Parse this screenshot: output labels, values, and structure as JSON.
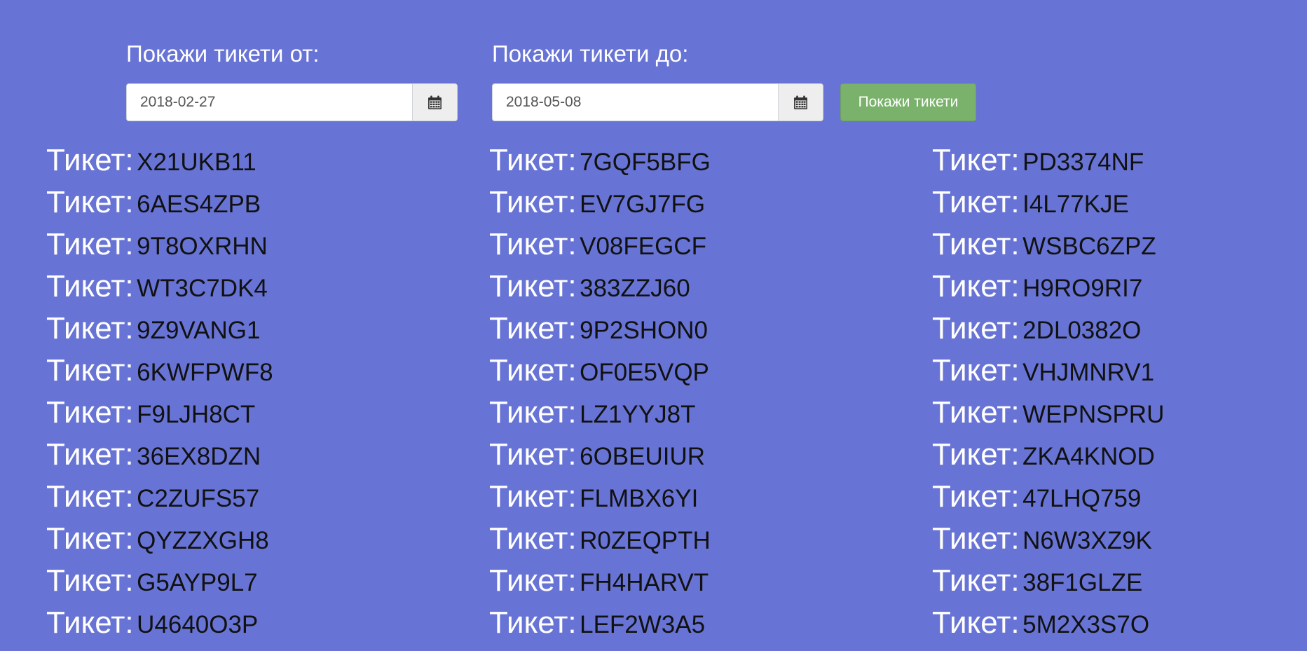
{
  "filters": {
    "from_label": "Покажи тикети от:",
    "to_label": "Покажи тикети до:",
    "from_value": "2018-02-27",
    "to_value": "2018-05-08",
    "calendar_icon": "calendar-icon",
    "submit_label": "Покажи тикети"
  },
  "ticket_prefix": "Тикет:",
  "columns": [
    [
      "X21UKB11",
      "6AES4ZPB",
      "9T8OXRHN",
      "WT3C7DK4",
      "9Z9VANG1",
      "6KWFPWF8",
      "F9LJH8CT",
      "36EX8DZN",
      "C2ZUFS57",
      "QYZZXGH8",
      "G5AYP9L7",
      "U4640O3P"
    ],
    [
      "7GQF5BFG",
      "EV7GJ7FG",
      "V08FEGCF",
      "383ZZJ60",
      "9P2SHON0",
      "OF0E5VQP",
      "LZ1YYJ8T",
      "6OBEUIUR",
      "FLMBX6YI",
      "R0ZEQPTH",
      "FH4HARVT",
      "LEF2W3A5"
    ],
    [
      "PD3374NF",
      "I4L77KJE",
      "WSBC6ZPZ",
      "H9RO9RI7",
      "2DL0382O",
      "VHJMNRV1",
      "WEPNSPRU",
      "ZKA4KNOD",
      "47LHQ759",
      "N6W3XZ9K",
      "38F1GLZE",
      "5M2X3S7O"
    ]
  ],
  "colors": {
    "background": "#6874d5",
    "button": "#7ab26c",
    "ticket_label": "#ffffff",
    "ticket_code": "#111111"
  }
}
